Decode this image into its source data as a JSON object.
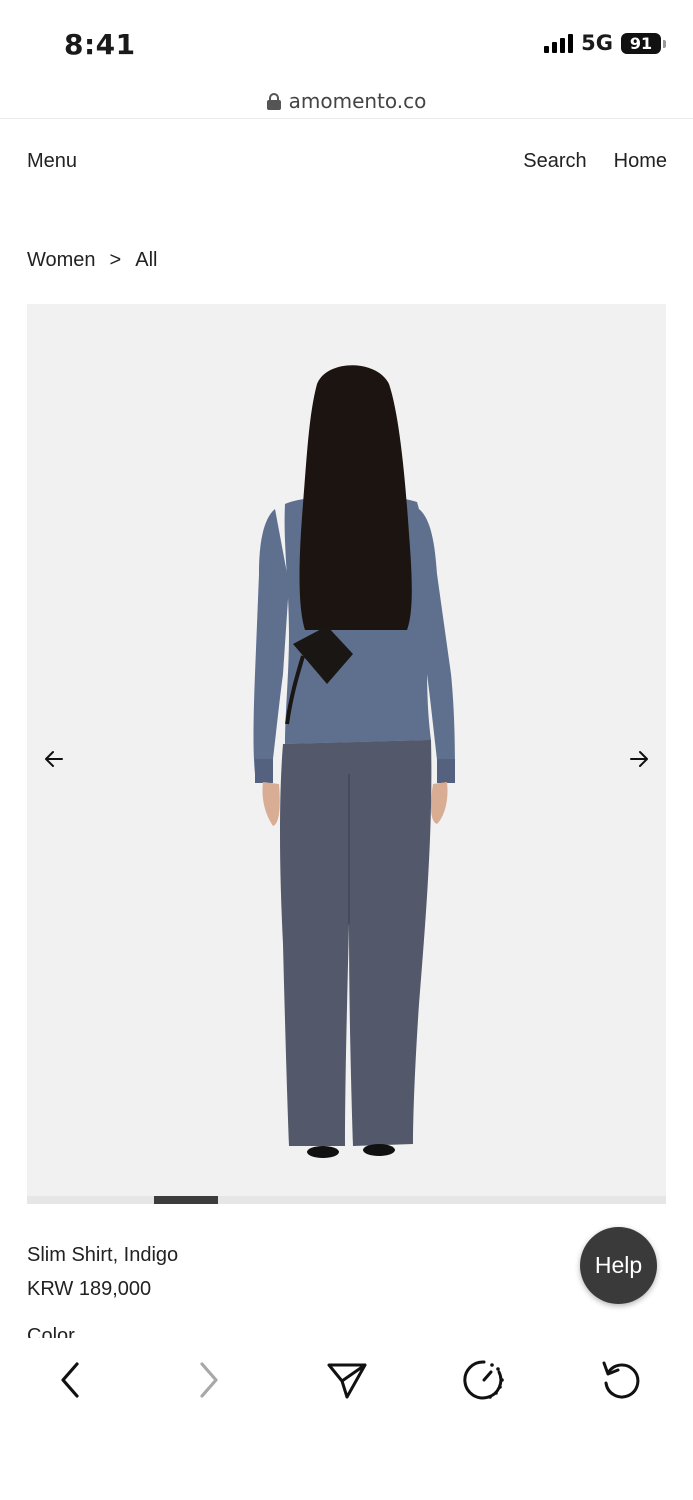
{
  "status_bar": {
    "time": "8:41",
    "network": "5G",
    "battery": "91"
  },
  "browser": {
    "url": "amomento.co"
  },
  "site_nav": {
    "menu": "Menu",
    "search": "Search",
    "home": "Home"
  },
  "breadcrumb": {
    "level1": "Women",
    "separator": ">",
    "level2": "All"
  },
  "gallery": {
    "image_index": 2,
    "image_count": 10
  },
  "product": {
    "name": "Slim Shirt, Indigo",
    "price": "KRW 189,000",
    "next_label_partial": "Color"
  },
  "help": {
    "label": "Help"
  },
  "icons": {
    "prev_image": "arrow-left-icon",
    "next_image": "arrow-right-icon",
    "back": "chevron-left-icon",
    "forward": "chevron-right-icon",
    "share": "send-icon",
    "timer": "timer-icon",
    "reload": "reload-icon"
  },
  "colors": {
    "shirt": "#5f708f",
    "pants": "#53586a",
    "hair": "#1c1410",
    "gallery_bg": "#f1f1f1",
    "help_bg": "#3a3a3a"
  }
}
